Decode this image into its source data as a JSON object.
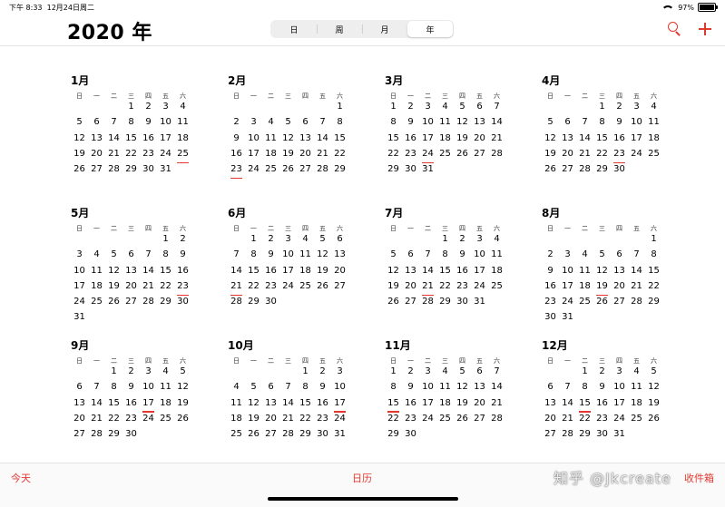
{
  "status": {
    "time": "下午 8:33",
    "date": "12月24日周二",
    "battery": "97%",
    "battery_level": 0.97
  },
  "header": {
    "title": "2020 年",
    "segments": [
      {
        "label": "日",
        "active": false
      },
      {
        "label": "周",
        "active": false
      },
      {
        "label": "月",
        "active": false
      },
      {
        "label": "年",
        "active": true
      }
    ]
  },
  "weekdays": [
    "日",
    "一",
    "二",
    "三",
    "四",
    "五",
    "六"
  ],
  "months": [
    {
      "title": "1月",
      "start": 3,
      "days": 31,
      "marked": [
        25
      ]
    },
    {
      "title": "2月",
      "start": 6,
      "days": 29,
      "marked": [
        23
      ]
    },
    {
      "title": "3月",
      "start": 0,
      "days": 31,
      "marked": [
        24
      ]
    },
    {
      "title": "4月",
      "start": 3,
      "days": 30,
      "marked": [
        23
      ]
    },
    {
      "title": "5月",
      "start": 5,
      "days": 31,
      "marked": [
        23
      ]
    },
    {
      "title": "6月",
      "start": 1,
      "days": 30,
      "marked": [
        21
      ]
    },
    {
      "title": "7月",
      "start": 3,
      "days": 31,
      "marked": [
        21
      ]
    },
    {
      "title": "8月",
      "start": 6,
      "days": 31,
      "marked": [
        19
      ]
    },
    {
      "title": "9月",
      "start": 2,
      "days": 30,
      "marked": [
        17
      ]
    },
    {
      "title": "10月",
      "start": 4,
      "days": 31,
      "marked": [
        17
      ]
    },
    {
      "title": "11月",
      "start": 0,
      "days": 30,
      "marked": [
        15
      ]
    },
    {
      "title": "12月",
      "start": 2,
      "days": 31,
      "marked": [
        15
      ]
    }
  ],
  "toolbar": {
    "today": "今天",
    "calendars": "日历",
    "inbox": "收件箱"
  },
  "watermark": "知乎 @Jkcreate",
  "colors": {
    "accent": "#e2382f"
  }
}
